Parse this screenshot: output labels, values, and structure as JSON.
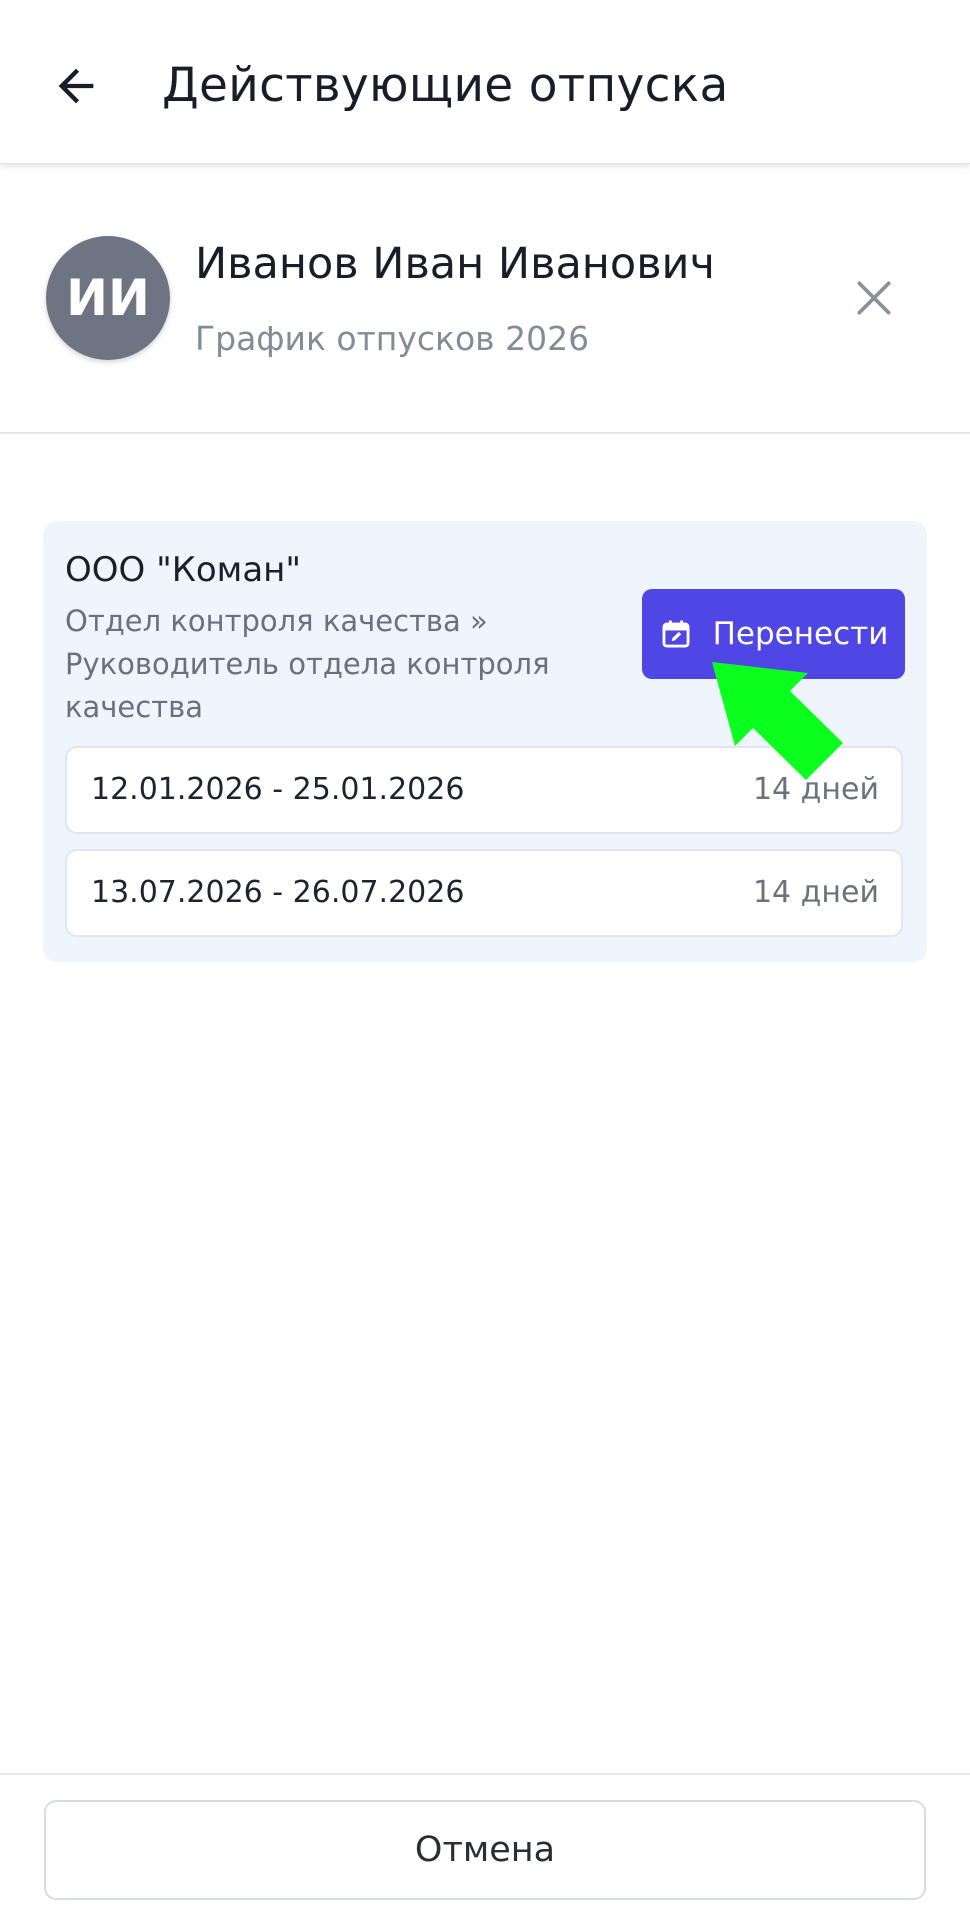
{
  "appbar": {
    "title": "Действующие отпуска",
    "back_icon": "arrow-left-icon"
  },
  "employee": {
    "initials": "ИИ",
    "name": "Иванов Иван Иванович",
    "subtitle": "График отпусков 2026",
    "close_icon": "close-icon"
  },
  "card": {
    "company": "ООО \"Коман\"",
    "department": "Отдел контроля качества » Руководитель отдела контроля качества",
    "move_button": {
      "label": "Перенести",
      "icon": "calendar-edit-icon",
      "color": "#4f46e5"
    },
    "periods": [
      {
        "dates": "12.01.2026 - 25.01.2026",
        "days": "14 дней"
      },
      {
        "dates": "13.07.2026 - 26.07.2026",
        "days": "14 дней"
      }
    ]
  },
  "footer": {
    "cancel_label": "Отмена"
  },
  "colors": {
    "accent": "#4f46e5",
    "card_bg": "#eef5fd",
    "avatar_bg": "#6f7482",
    "pointer_arrow": "#0bff1e"
  }
}
